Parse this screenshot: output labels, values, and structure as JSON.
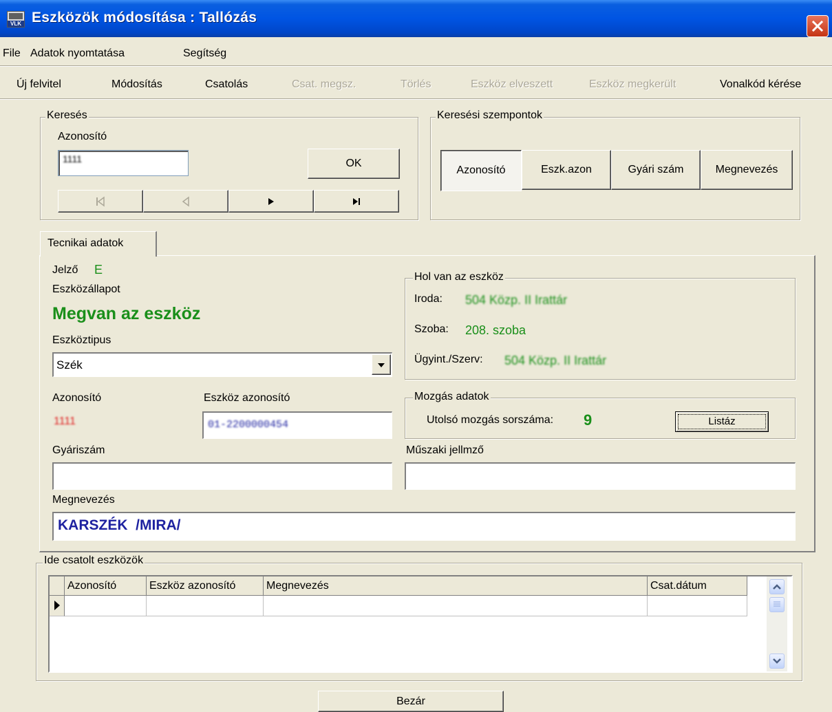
{
  "window": {
    "title": "Eszközök módosítása : Tallózás",
    "app_icon_text": "VLK",
    "close_icon": "close-x-icon",
    "accent": "#0054e3",
    "close_color": "#d54524"
  },
  "menu": {
    "file": "File",
    "print": "Adatok nyomtatása",
    "help": "Segítség"
  },
  "toolbar": {
    "new": "Új felvitel",
    "modify": "Módosítás",
    "attach": "Csatolás",
    "detach": "Csat. megsz.",
    "delete": "Törlés",
    "lost": "Eszköz elveszett",
    "found": "Eszköz megkerült",
    "barcode": "Vonalkód kérése"
  },
  "search": {
    "legend": "Keresés",
    "id_label": "Azonosító",
    "id_value": "1111",
    "ok_label": "OK",
    "nav_icons": [
      "first-record-icon",
      "prev-record-icon",
      "next-record-icon",
      "last-record-icon"
    ]
  },
  "criteria": {
    "legend": "Keresési szempontok",
    "options": [
      "Azonosító",
      "Eszk.azon",
      "Gyári szám",
      "Megnevezés"
    ],
    "selected": "Azonosító"
  },
  "tab": {
    "label": "Tecnikai adatok"
  },
  "tech": {
    "jelzo_label": "Jelző",
    "jelzo_value": "E",
    "state_label": "Eszközállapot",
    "state_value": "Megvan az eszköz",
    "type_label": "Eszköztipus",
    "type_value": "Szék",
    "id_label": "Azonosító",
    "id_value": "1111",
    "asset_id_label": "Eszköz azonosító",
    "asset_id_value": "01-2200000454",
    "serial_label": "Gyáriszám",
    "serial_value": "",
    "name_label": "Megnevezés",
    "name_value": "KARSZÉK  /MIRA/",
    "tech_spec_label": "Műszaki jellmző",
    "tech_spec_value": ""
  },
  "location": {
    "legend": "Hol van az eszköz",
    "office_label": "Iroda:",
    "office_value": "504 Közp. II Irattár",
    "room_label": "Szoba:",
    "room_value": "208. szoba",
    "agent_label": "Ügyint./Szerv:",
    "agent_value": "504 Közp. II Irattár"
  },
  "movement": {
    "legend": "Mozgás adatok",
    "last_label": "Utolsó mozgás sorszáma:",
    "last_value": "9",
    "list_button": "Listáz"
  },
  "attached": {
    "legend": "Ide csatolt eszközök",
    "columns": [
      "Azonosító",
      "Eszköz azonosító",
      "Megnevezés",
      "Csat.dátum"
    ],
    "row_indicator_icon": "current-row-arrow-icon",
    "scroll_up_icon": "scroll-up-icon",
    "scroll_down_icon": "scroll-down-icon"
  },
  "footer": {
    "close_label": "Bezár"
  }
}
